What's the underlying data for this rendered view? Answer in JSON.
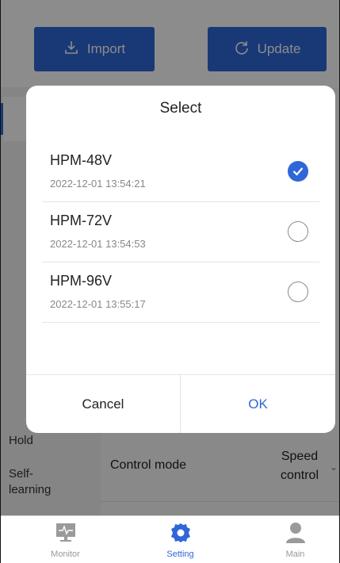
{
  "header": {
    "import_label": "Import",
    "update_label": "Update"
  },
  "sidebar": {
    "items": [
      "Hold",
      "Self-\nlearning"
    ]
  },
  "content": {
    "control_mode_label": "Control mode",
    "control_mode_value": "Speed\ncontrol"
  },
  "dialog": {
    "title": "Select",
    "options": [
      {
        "name": "HPM-48V",
        "date": "2022-12-01 13:54:21",
        "selected": true
      },
      {
        "name": "HPM-72V",
        "date": "2022-12-01 13:54:53",
        "selected": false
      },
      {
        "name": "HPM-96V",
        "date": "2022-12-01 13:55:17",
        "selected": false
      }
    ],
    "cancel_label": "Cancel",
    "ok_label": "OK"
  },
  "tabs": [
    {
      "label": "Monitor",
      "icon": "monitor-icon",
      "active": false
    },
    {
      "label": "Setting",
      "icon": "gear-icon",
      "active": true
    },
    {
      "label": "Main",
      "icon": "person-icon",
      "active": false
    }
  ],
  "colors": {
    "accent": "#2f67d8",
    "overlay": "rgba(0,0,0,0.45)"
  }
}
